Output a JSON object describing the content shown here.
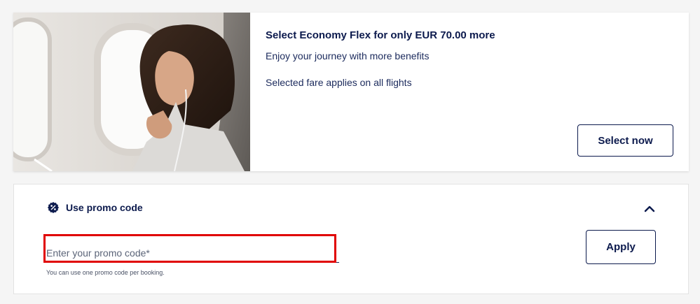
{
  "upsell": {
    "title": "Select Economy Flex for only EUR 70.00 more",
    "line1": "Enjoy your journey with more benefits",
    "line2": "Selected fare applies on all flights",
    "button_label": "Select now"
  },
  "promo": {
    "title": "Use promo code",
    "input_placeholder": "Enter your promo code*",
    "input_value": "",
    "hint": "You can use one promo code per booking.",
    "apply_label": "Apply"
  },
  "colors": {
    "brand_navy": "#0c1a4d",
    "highlight_red": "#e00000",
    "page_background": "#f5f5f5"
  },
  "icons": {
    "promo": "percent-badge-icon",
    "collapse": "chevron-up-icon"
  }
}
